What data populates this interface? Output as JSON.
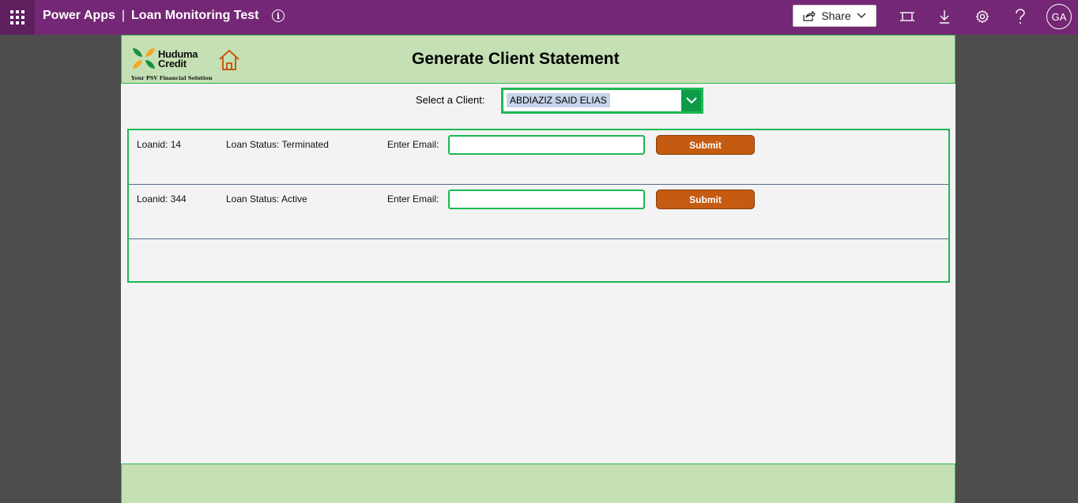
{
  "topbar": {
    "app_name": "Power Apps",
    "separator": "|",
    "app_title": "Loan Monitoring Test",
    "share_label": "Share",
    "avatar_initials": "GA",
    "bg_color": "#742774"
  },
  "header": {
    "logo_name": "Huduma Credit",
    "logo_line1": "Huduma",
    "logo_line2": "Credit",
    "logo_tagline": "Your PSV Financial Solution",
    "page_title": "Generate Client Statement"
  },
  "client_select": {
    "label": "Select a Client:",
    "value": "ABDIAZIZ SAID ELIAS"
  },
  "loans": [
    {
      "loanid": "Loanid: 14",
      "status": "Loan Status: Terminated",
      "email_label": "Enter Email:",
      "email_value": "",
      "submit_label": "Submit"
    },
    {
      "loanid": "Loanid: 344",
      "status": "Loan Status: Active",
      "email_label": "Enter Email:",
      "email_value": "",
      "submit_label": "Submit"
    }
  ],
  "colors": {
    "band": "#c5e0b4",
    "accent_green": "#1db954",
    "submit_orange": "#c55a11"
  }
}
